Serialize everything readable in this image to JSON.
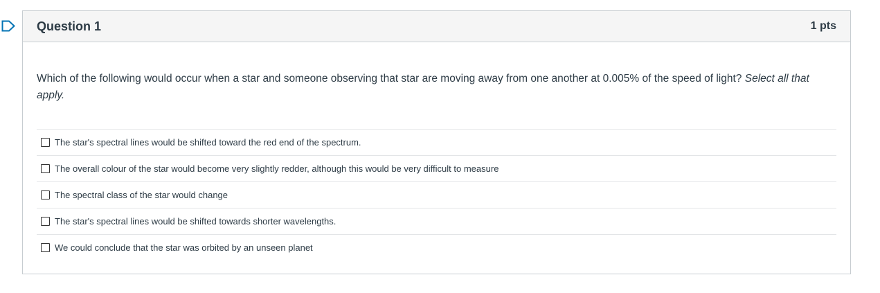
{
  "question": {
    "title": "Question 1",
    "points": "1 pts",
    "text": "Which of the following would occur when a star and someone observing that star are moving away from one another at 0.005% of the speed of light?",
    "instruction": "Select all that apply."
  },
  "answers": [
    {
      "label": "The star's spectral lines would be shifted toward the red end of the spectrum.",
      "checked": false
    },
    {
      "label": "The overall colour of the star would become very slightly redder, although this would be very difficult to measure",
      "checked": false
    },
    {
      "label": "The spectral class of the star would change",
      "checked": false
    },
    {
      "label": "The star's spectral lines would be shifted towards shorter wavelengths.",
      "checked": false
    },
    {
      "label": "We could conclude that the star was orbited by an unseen planet",
      "checked": false
    }
  ],
  "icons": {
    "flag": "bookmark-flag-icon"
  },
  "colors": {
    "flag_stroke": "#0374b5",
    "header_bg": "#f5f5f5",
    "border": "#c7cdd1",
    "text": "#2d3b45"
  }
}
